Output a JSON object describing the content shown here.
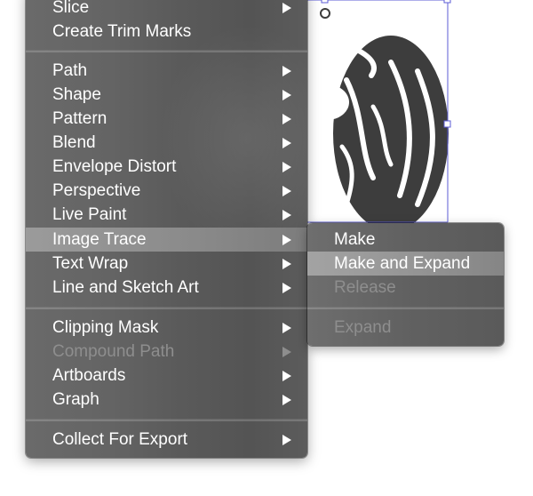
{
  "colors": {
    "menu_bg": "#5f5f5f",
    "highlight": "#8f8f8f",
    "text": "#ffffff",
    "disabled_text": "#8e8e8e",
    "selection_outline": "#5b5bd6",
    "artwork_fill": "#3f3f3f"
  },
  "object_menu": {
    "items": [
      {
        "label": "Slice",
        "submenu": true,
        "state": "normal"
      },
      {
        "label": "Create Trim Marks",
        "submenu": false,
        "state": "normal"
      },
      {
        "label": "Path",
        "submenu": true,
        "state": "normal"
      },
      {
        "label": "Shape",
        "submenu": true,
        "state": "normal"
      },
      {
        "label": "Pattern",
        "submenu": true,
        "state": "normal"
      },
      {
        "label": "Blend",
        "submenu": true,
        "state": "normal"
      },
      {
        "label": "Envelope Distort",
        "submenu": true,
        "state": "normal"
      },
      {
        "label": "Perspective",
        "submenu": true,
        "state": "normal"
      },
      {
        "label": "Live Paint",
        "submenu": true,
        "state": "normal"
      },
      {
        "label": "Image Trace",
        "submenu": true,
        "state": "highlighted"
      },
      {
        "label": "Text Wrap",
        "submenu": true,
        "state": "normal"
      },
      {
        "label": "Line and Sketch Art",
        "submenu": true,
        "state": "normal"
      },
      {
        "label": "Clipping Mask",
        "submenu": true,
        "state": "normal"
      },
      {
        "label": "Compound Path",
        "submenu": true,
        "state": "disabled"
      },
      {
        "label": "Artboards",
        "submenu": true,
        "state": "normal"
      },
      {
        "label": "Graph",
        "submenu": true,
        "state": "normal"
      },
      {
        "label": "Collect For Export",
        "submenu": true,
        "state": "normal"
      }
    ]
  },
  "image_trace_submenu": {
    "items": [
      {
        "label": "Make",
        "state": "normal"
      },
      {
        "label": "Make and Expand",
        "state": "highlighted"
      },
      {
        "label": "Release",
        "state": "disabled"
      },
      {
        "label": "Expand",
        "state": "disabled"
      }
    ]
  }
}
